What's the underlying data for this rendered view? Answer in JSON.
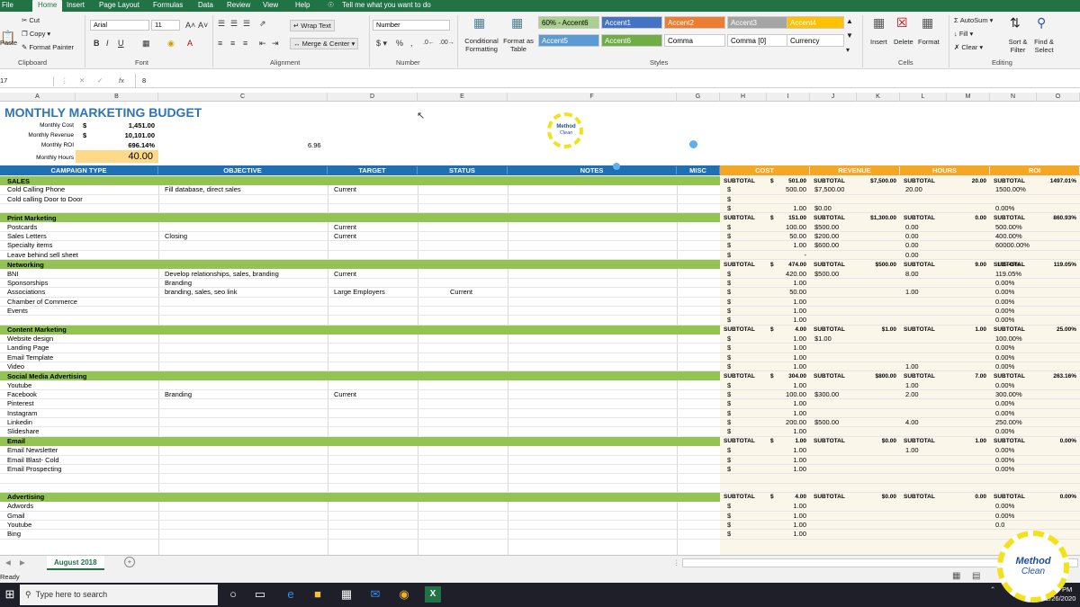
{
  "menu": {
    "tabs": [
      "File",
      "Home",
      "Insert",
      "Page Layout",
      "Formulas",
      "Data",
      "Review",
      "View",
      "Help"
    ],
    "tellme": "Tell me what you want to do"
  },
  "ribbon": {
    "clipboard": {
      "paste": "Paste",
      "cut": "Cut",
      "copy": "Copy",
      "format_painter": "Format Painter",
      "label": "Clipboard"
    },
    "font": {
      "name": "Arial",
      "size": "11",
      "label": "Font"
    },
    "alignment": {
      "wrap": "Wrap Text",
      "merge": "Merge & Center",
      "label": "Alignment"
    },
    "number": {
      "format": "Number",
      "label": "Number"
    },
    "styles": {
      "conditional": "Conditional Formatting",
      "format_table": "Format as Table",
      "label": "Styles",
      "cells": [
        {
          "text": "60% - Accent6",
          "bg": "#a9d08e",
          "fg": "#000000"
        },
        {
          "text": "Accent1",
          "bg": "#4472c4",
          "fg": "#ffffff"
        },
        {
          "text": "Accent2",
          "bg": "#ed7d31",
          "fg": "#ffffff"
        },
        {
          "text": "Accent3",
          "bg": "#a5a5a5",
          "fg": "#ffffff"
        },
        {
          "text": "Accent4",
          "bg": "#ffc000",
          "fg": "#ffffff"
        },
        {
          "text": "Accent5",
          "bg": "#5b9bd5",
          "fg": "#ffffff"
        },
        {
          "text": "Accent6",
          "bg": "#70ad47",
          "fg": "#ffffff"
        },
        {
          "text": "Comma",
          "bg": "#ffffff",
          "fg": "#000000"
        },
        {
          "text": "Comma [0]",
          "bg": "#ffffff",
          "fg": "#000000"
        },
        {
          "text": "Currency",
          "bg": "#ffffff",
          "fg": "#000000"
        }
      ]
    },
    "cells": {
      "insert": "Insert",
      "delete": "Delete",
      "format": "Format",
      "label": "Cells"
    },
    "editing": {
      "autosum": "AutoSum",
      "fill": "Fill",
      "clear": "Clear",
      "sort": "Sort & Filter",
      "find": "Find & Select",
      "label": "Editing"
    }
  },
  "formula": {
    "namebox": "17",
    "fx": "fx",
    "value": "8"
  },
  "columns": [
    "A",
    "B",
    "C",
    "D",
    "E",
    "F",
    "G",
    "H",
    "I",
    "J",
    "K",
    "L",
    "M",
    "N",
    "O"
  ],
  "summary": {
    "title": "MONTHLY MARKETING BUDGET",
    "rows": [
      {
        "label": "Monthly Cost",
        "sym": "$",
        "value": "1,451.00"
      },
      {
        "label": "Monthly Revenue",
        "sym": "$",
        "value": "10,101.00"
      },
      {
        "label": "Monthly ROI",
        "sym": "",
        "value": "696.14%"
      }
    ],
    "hours_label": "Monthly Hours",
    "hours_value": "40.00",
    "extra": "6.96"
  },
  "headers": {
    "left": [
      "CAMPAIGN TYPE",
      "OBJECTIVE",
      "TARGET",
      "STATUS",
      "NOTES",
      "MISC"
    ],
    "right": [
      "COST",
      "REVENUE",
      "HOURS",
      "ROI"
    ]
  },
  "rows": [
    {
      "t": "s",
      "a": "SALES",
      "cs": "501.00",
      "rs": "$7,500.00",
      "hs": "20.00",
      "os": "1497.01%"
    },
    {
      "a": "Cold Calling Phone",
      "c": "Fill database, direct sales",
      "d": "Current",
      "cost": "500.00",
      "rev": "$7,500.00",
      "hrs": "20.00",
      "roi": "1500.00%"
    },
    {
      "a": "Cold calling Door to Door",
      "cost": "",
      "roi": ""
    },
    {
      "a": "",
      "cost": "1.00",
      "rev": "$0.00",
      "roi": "0.00%"
    },
    {
      "t": "s",
      "a": "Print Marketing",
      "cs": "151.00",
      "rs": "$1,300.00",
      "hs": "0.00",
      "os": "860.93%"
    },
    {
      "a": "Postcards",
      "d": "Current",
      "cost": "100.00",
      "rev": "$500.00",
      "hrs": "0.00",
      "roi": "500.00%"
    },
    {
      "a": "Sales Letters",
      "c": "Closing",
      "d": "Current",
      "cost": "50.00",
      "rev": "$200.00",
      "hrs": "0.00",
      "roi": "400.00%"
    },
    {
      "a": "Specialty items",
      "cost": "1.00",
      "rev": "$600.00",
      "hrs": "0.00",
      "roi": "60000.00%"
    },
    {
      "a": "Leave behind sell sheet",
      "cost": "-",
      "hrs": "0.00"
    },
    {
      "t": "s",
      "a": "Networking",
      "cs": "474.00",
      "rs": "$500.00",
      "hs": "9.00",
      "os": "119.05%",
      "ox": "105.49%"
    },
    {
      "a": "BNI",
      "c": "Develop relationships, sales, branding",
      "d": "Current",
      "cost": "420.00",
      "rev": "$500.00",
      "hrs": "8.00",
      "roi": "119.05%"
    },
    {
      "a": "Sponsorships",
      "c": "Branding",
      "cost": "1.00",
      "roi": "0.00%"
    },
    {
      "a": "Associations",
      "c": "branding, sales, seo link",
      "d": "Large Employers",
      "e": "Current",
      "cost": "50.00",
      "hrs": "1.00",
      "roi": "0.00%"
    },
    {
      "a": "Chamber of Commerce",
      "cost": "1.00",
      "roi": "0.00%"
    },
    {
      "a": "Events",
      "cost": "1.00",
      "roi": "0.00%"
    },
    {
      "a": "",
      "cost": "1.00",
      "roi": "0.00%"
    },
    {
      "t": "s",
      "a": "Content Marketing",
      "cs": "4.00",
      "rs": "$1.00",
      "hs": "1.00",
      "os": "25.00%"
    },
    {
      "a": "Website design",
      "cost": "1.00",
      "rev": "$1.00",
      "roi": "100.00%"
    },
    {
      "a": "Landing Page",
      "cost": "1.00",
      "roi": "0.00%"
    },
    {
      "a": "Email Template",
      "cost": "1.00",
      "roi": "0.00%"
    },
    {
      "a": "Video",
      "cost": "1.00",
      "hrs": "1.00",
      "roi": "0.00%"
    },
    {
      "t": "s",
      "a": "Social Media Advertising",
      "cs": "304.00",
      "rs": "$800.00",
      "hs": "7.00",
      "os": "263.16%"
    },
    {
      "a": "Youtube",
      "cost": "1.00",
      "hrs": "1.00",
      "roi": "0.00%"
    },
    {
      "a": "Facebook",
      "c": "Branding",
      "d": "Current",
      "cost": "100.00",
      "rev": "$300.00",
      "hrs": "2.00",
      "roi": "300.00%"
    },
    {
      "a": "Pinterest",
      "cost": "1.00",
      "roi": "0.00%"
    },
    {
      "a": "Instagram",
      "cost": "1.00",
      "roi": "0.00%"
    },
    {
      "a": "Linkedin",
      "cost": "200.00",
      "rev": "$500.00",
      "hrs": "4.00",
      "roi": "250.00%"
    },
    {
      "a": "Slideshare",
      "cost": "1.00",
      "roi": "0.00%"
    },
    {
      "t": "s",
      "a": "Email",
      "cs": "1.00",
      "rs": "$0.00",
      "hs": "1.00",
      "os": "0.00%"
    },
    {
      "a": "Email Newsletter",
      "cost": "1.00",
      "hrs": "1.00",
      "roi": "0.00%"
    },
    {
      "a": "Email Blast- Cold",
      "cost": "1.00",
      "roi": "0.00%"
    },
    {
      "a": "Email Prospecting",
      "cost": "1.00",
      "roi": "0.00%"
    },
    {
      "a": ""
    },
    {
      "a": ""
    },
    {
      "t": "s",
      "a": "Advertising",
      "cs": "4.00",
      "rs": "$0.00",
      "hs": "0.00",
      "os": "0.00%"
    },
    {
      "a": "Adwords",
      "cost": "1.00",
      "roi": "0.00%"
    },
    {
      "a": "Gmail",
      "cost": "1.00",
      "roi": "0.00%"
    },
    {
      "a": "Youtube",
      "cost": "1.00",
      "roi": "0.0"
    },
    {
      "a": "Bing",
      "cost": "1.00"
    }
  ],
  "subtotal_label": "SUBTOTAL",
  "dollar": "$",
  "sheet_tab": "August 2018",
  "status": "Ready",
  "logo": {
    "line1": "Method",
    "line2": "Clean"
  },
  "taskbar": {
    "search": "Type here to search",
    "time": "PM",
    "date": "2/26/2020"
  }
}
